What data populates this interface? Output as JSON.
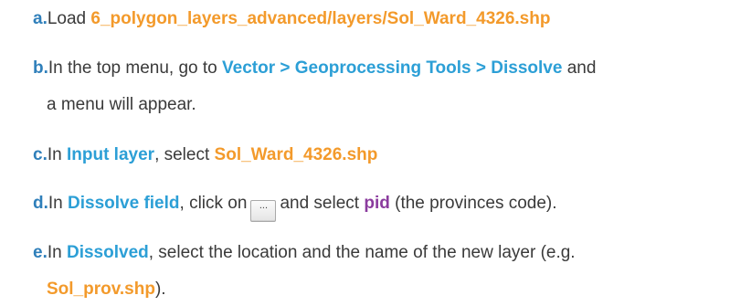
{
  "steps": [
    {
      "letter": "a.",
      "parts": [
        {
          "text": "Load ",
          "style": "plain"
        },
        {
          "text": "6_polygon_layers_advanced/layers/Sol_Ward_4326.shp",
          "style": "orange"
        }
      ]
    },
    {
      "letter": "b.",
      "line1": [
        {
          "text": "In the top menu, go to ",
          "style": "plain"
        },
        {
          "text": "Vector > Geoprocessing Tools > Dissolve",
          "style": "blue"
        },
        {
          "text": " and",
          "style": "plain"
        }
      ],
      "line2": "a menu will appear."
    },
    {
      "letter": "c.",
      "parts": [
        {
          "text": "In ",
          "style": "plain"
        },
        {
          "text": "Input layer",
          "style": "blue"
        },
        {
          "text": ", select ",
          "style": "plain"
        },
        {
          "text": "Sol_Ward_4326.shp",
          "style": "orange"
        }
      ]
    },
    {
      "letter": "d.",
      "parts": [
        {
          "text": "In ",
          "style": "plain"
        },
        {
          "text": "Dissolve field",
          "style": "blue"
        },
        {
          "text": ", click on",
          "style": "plain"
        },
        {
          "text": "and select ",
          "style": "plain"
        },
        {
          "text": "pid",
          "style": "purple"
        },
        {
          "text": " (the provinces code).",
          "style": "plain"
        }
      ],
      "button_label": "..."
    },
    {
      "letter": "e.",
      "line1": [
        {
          "text": "In ",
          "style": "plain"
        },
        {
          "text": "Dissolved",
          "style": "blue"
        },
        {
          "text": ", select the location and the name of the new layer (e.g.",
          "style": "plain"
        }
      ],
      "line2": [
        {
          "text": "Sol_prov.shp",
          "style": "orange"
        },
        {
          "text": ").",
          "style": "plain"
        }
      ]
    }
  ]
}
